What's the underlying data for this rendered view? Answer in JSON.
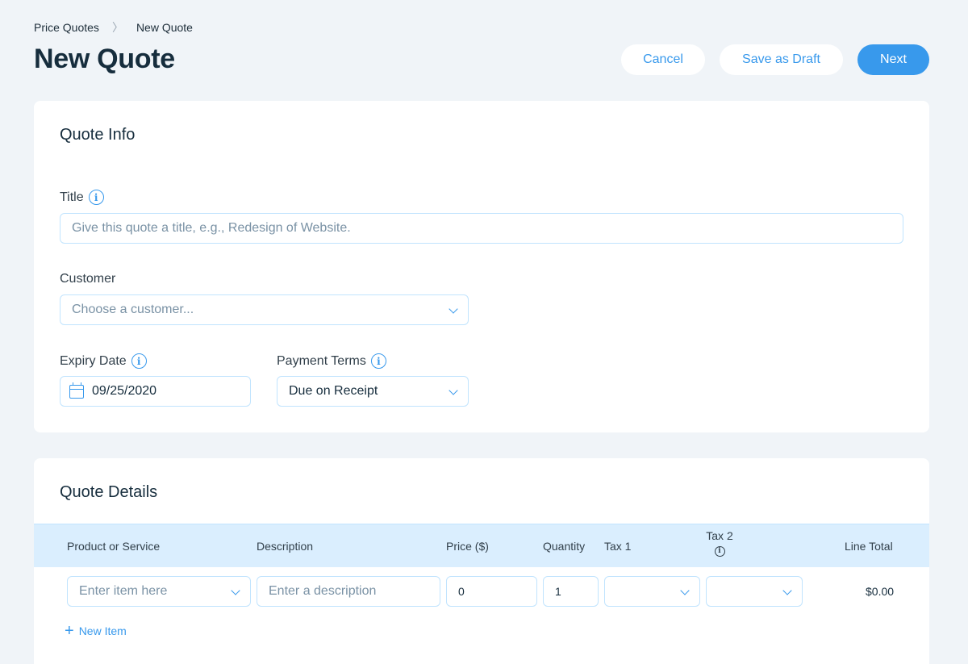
{
  "breadcrumb": {
    "parent": "Price Quotes",
    "separator": "〉",
    "current": "New Quote"
  },
  "page_title": "New Quote",
  "actions": {
    "cancel": "Cancel",
    "save_draft": "Save as Draft",
    "next": "Next"
  },
  "quote_info": {
    "title": "Quote Info",
    "title_field": {
      "label": "Title",
      "placeholder": "Give this quote a title, e.g., Redesign of Website."
    },
    "customer_field": {
      "label": "Customer",
      "placeholder": "Choose a customer..."
    },
    "expiry_field": {
      "label": "Expiry Date",
      "value": "09/25/2020"
    },
    "payment_terms_field": {
      "label": "Payment Terms",
      "value": "Due on Receipt"
    },
    "info_glyph": "i"
  },
  "quote_details": {
    "title": "Quote Details",
    "columns": {
      "product": "Product or Service",
      "description": "Description",
      "price": "Price ($)",
      "quantity": "Quantity",
      "tax1": "Tax 1",
      "tax2": "Tax 2",
      "line_total": "Line Total"
    },
    "row": {
      "product_placeholder": "Enter item here",
      "description_placeholder": "Enter a description",
      "price": "0",
      "quantity": "1",
      "line_total": "$0.00"
    },
    "new_item": "New Item",
    "plus_glyph": "+"
  },
  "colors": {
    "accent": "#3899ec",
    "background": "#f0f4f8",
    "header_row": "#daeefe"
  }
}
